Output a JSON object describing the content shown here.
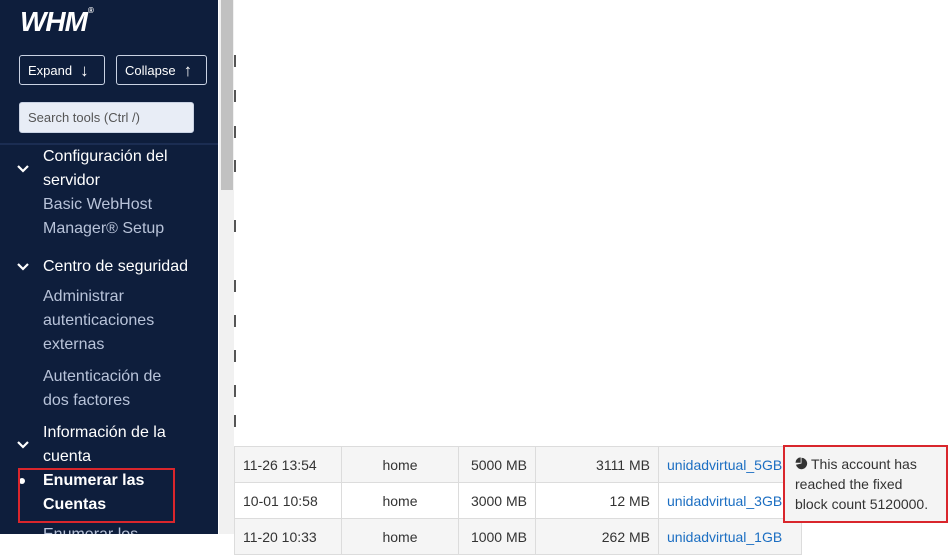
{
  "sidebar": {
    "logo": "WHM",
    "logo_mark": "®",
    "expand_label": "Expand",
    "collapse_label": "Collapse",
    "search_placeholder": "Search tools (Ctrl /)",
    "groups": [
      {
        "title_lines": [
          "Configuración del",
          "servidor"
        ],
        "items": [
          [
            "Basic WebHost",
            "Manager® Setup"
          ]
        ]
      },
      {
        "title_lines": [
          "Centro de seguridad"
        ],
        "items": [
          [
            "Administrar",
            "autenticaciones",
            "externas"
          ],
          [
            "Autenticación de",
            "dos factores"
          ]
        ]
      },
      {
        "title_lines": [
          "Información de la",
          "cuenta"
        ],
        "items": [
          [
            "Enumerar las",
            "Cuentas"
          ],
          [
            "Enumerar los"
          ]
        ]
      }
    ]
  },
  "table": {
    "rows": [
      {
        "date": "11-26 13:54",
        "home": "home",
        "quota": "5000 MB",
        "used": "3111 MB",
        "package": "unidadvirtual_5GB"
      },
      {
        "date": "10-01 10:58",
        "home": "home",
        "quota": "3000 MB",
        "used": "12 MB",
        "package": "unidadvirtual_3GB"
      },
      {
        "date": "11-20 10:33",
        "home": "home",
        "quota": "1000 MB",
        "used": "262 MB",
        "package": "unidadvirtual_1GB"
      }
    ]
  },
  "tooltip": {
    "icon": "pie-chart-icon",
    "text": "This account has reached the fixed block count 5120000."
  },
  "colors": {
    "sidebar_bg": "#0e1e3c",
    "highlight_border": "#d9262c",
    "link": "#1b6ec2"
  }
}
